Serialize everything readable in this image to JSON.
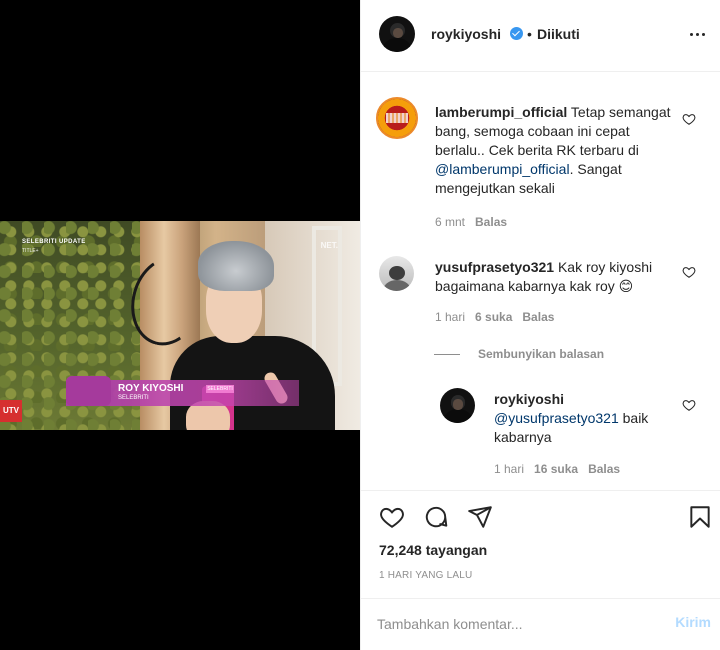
{
  "video": {
    "corner_tag": "SELEBRITI UPDATE",
    "corner_sub": "TITLE+",
    "channel_logo": "NET.",
    "lower_third_name": "ROY KIYOSHI",
    "lower_third_role": "SELEBRITI",
    "lower_third_chip": "SELEBRITI",
    "badge": "UTV"
  },
  "header": {
    "username": "roykiyoshi",
    "dot": "•",
    "follow_status": "Diikuti",
    "icons": {
      "verified": "verified-badge-icon",
      "more": "more-options-icon"
    }
  },
  "comments": [
    {
      "username": "lamberumpi_official",
      "text_before": " Tetap semangat bang, semoga cobaan ini cepat berlalu.. Cek berita RK terbaru di ",
      "mention": "@lamberumpi_official",
      "text_after": ". Sangat mengejutkan sekali",
      "time": "6 mnt",
      "reply": "Balas"
    },
    {
      "username": "yusufprasetyo321",
      "text": " Kak roy kiyoshi bagaimana kabarnya kak roy 😊",
      "time": "1 hari",
      "likes": "6 suka",
      "reply": "Balas",
      "hide_replies": "Sembunyikan balasan",
      "replies": [
        {
          "username": "roykiyoshi",
          "mention": "@yusufprasetyo321",
          "text": " baik kabarnya",
          "time": "1 hari",
          "likes": "16 suka",
          "reply": "Balas"
        }
      ]
    }
  ],
  "actions": {
    "icons": [
      "heart-icon",
      "comment-icon",
      "share-icon",
      "bookmark-icon"
    ],
    "views": "72,248 tayangan",
    "posted": "1 HARI YANG LALU"
  },
  "comment_box": {
    "placeholder": "Tambahkan komentar...",
    "post_label": "Kirim"
  },
  "colors": {
    "accent": "#3897f0",
    "mention": "#00376b",
    "muted": "#8e8e8e",
    "post_disabled": "#b3dbff"
  }
}
